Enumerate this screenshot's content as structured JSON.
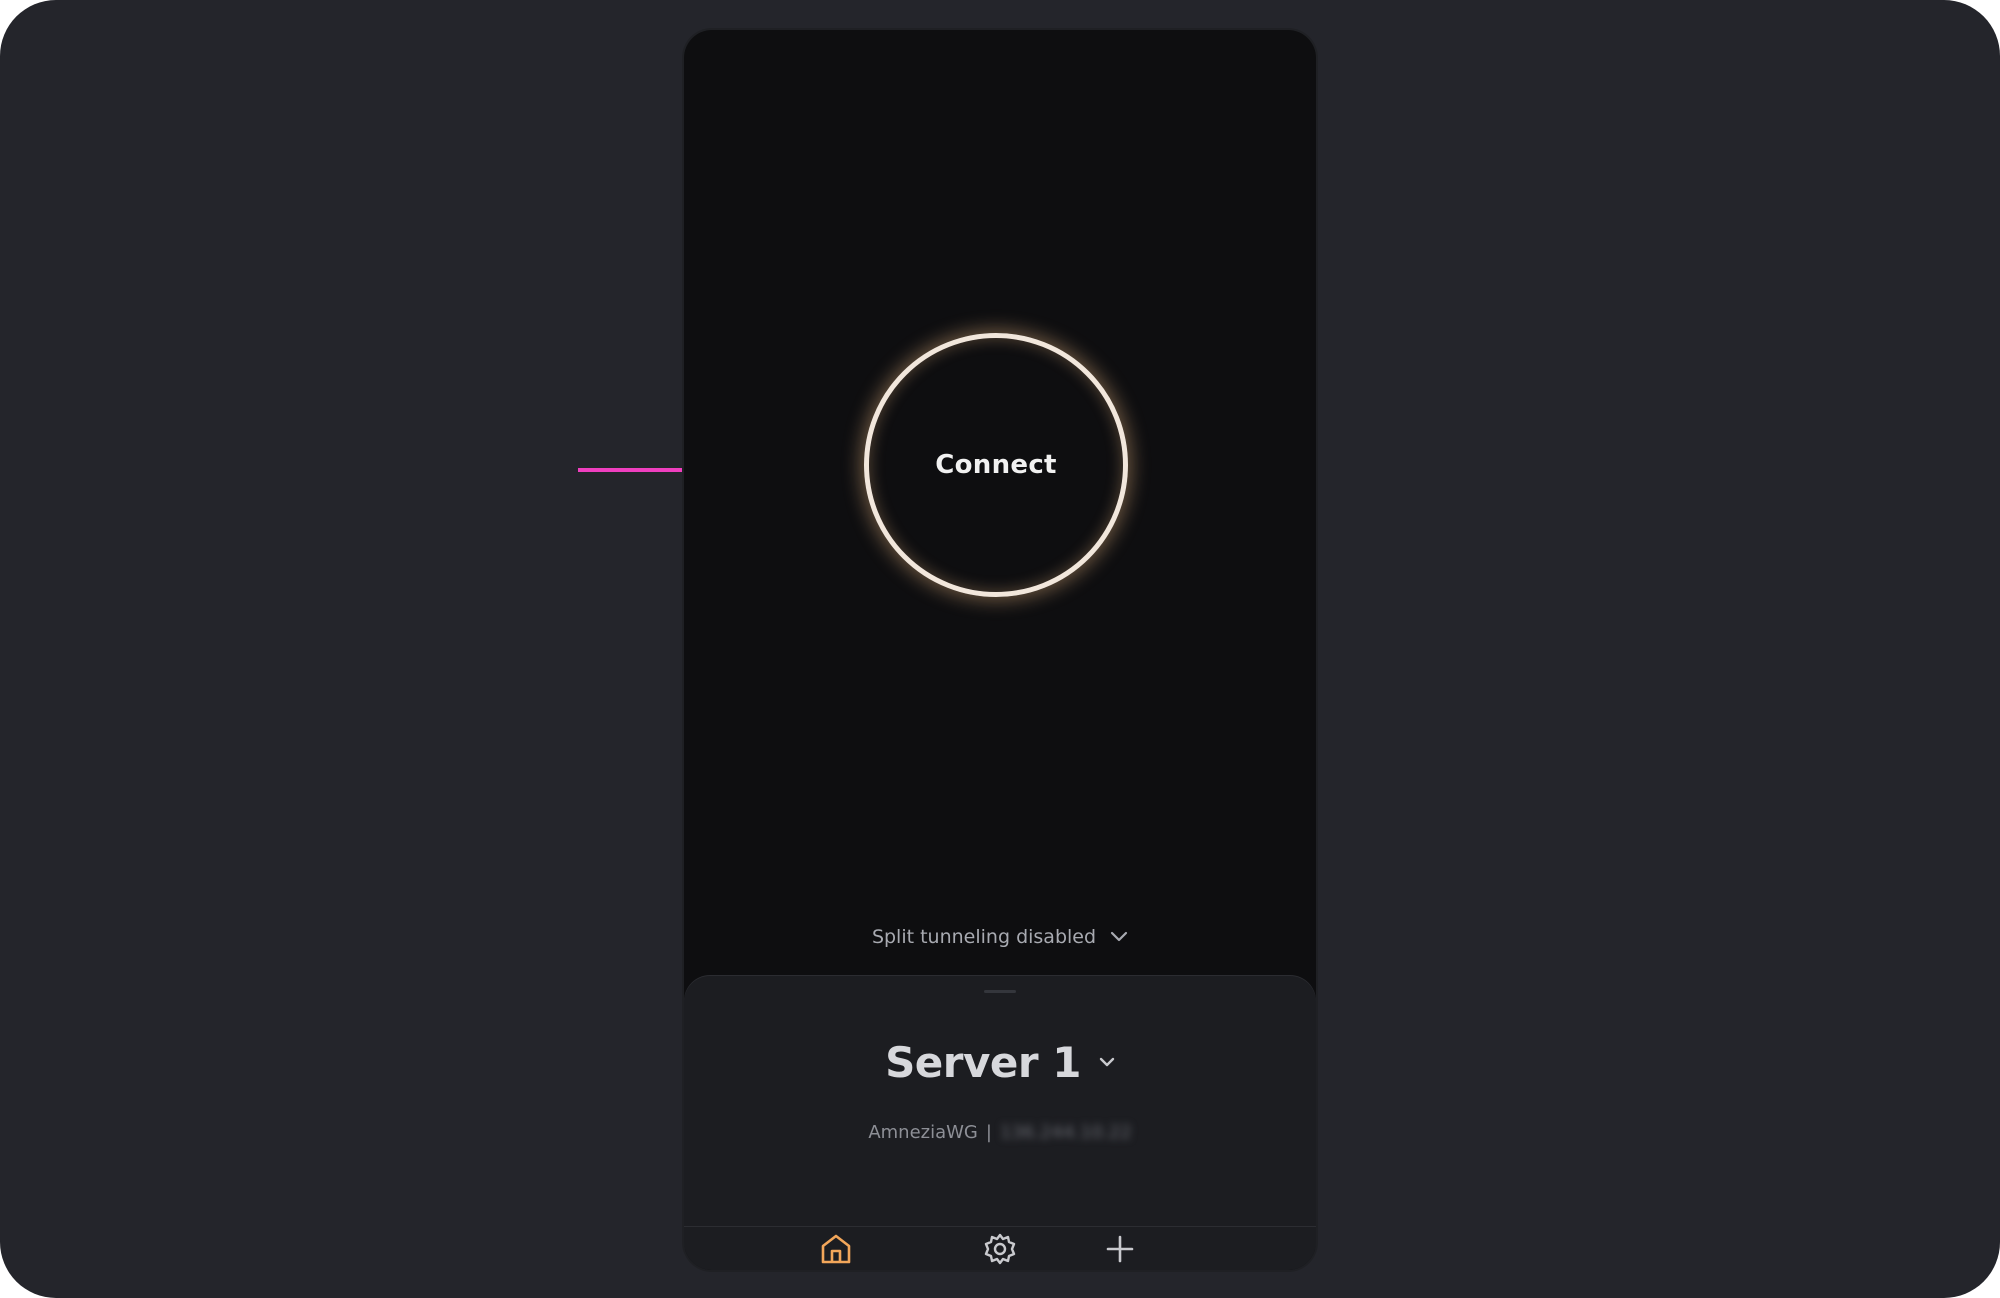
{
  "main": {
    "connect_label": "Connect",
    "split_tunneling_label": "Split tunneling disabled"
  },
  "server": {
    "name": "Server 1",
    "protocol": "AmneziaWG",
    "separator": "|",
    "address": "136.244.10.22"
  },
  "nav": {
    "items": [
      {
        "icon": "home-icon",
        "active": true
      },
      {
        "icon": "gear-icon",
        "active": false
      },
      {
        "icon": "plus-icon",
        "active": false
      }
    ]
  },
  "colors": {
    "accent": "#f2a65a",
    "ring": "#f2e7dc",
    "annotation_arrow": "#f03fbf",
    "screen_bg": "#0e0e10",
    "sheet_bg": "#1c1d21",
    "backdrop": "#24252b"
  }
}
